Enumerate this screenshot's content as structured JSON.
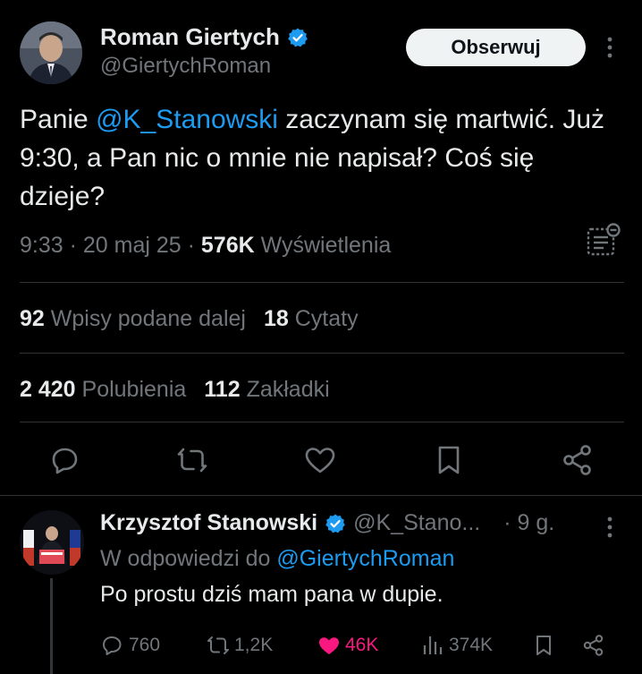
{
  "main_tweet": {
    "author_name": "Roman Giertych",
    "author_handle": "@GiertychRoman",
    "follow_label": "Obserwuj",
    "text_prefix": "Panie ",
    "text_mention": "@K_Stanowski",
    "text_rest": " zaczynam się martwić. Już 9:30, a Pan nic o mnie nie napisał? Coś się dzieje?",
    "time": "9:33",
    "date": "20 maj 25",
    "views_count": "576K",
    "views_label": "Wyświetlenia",
    "reposts_count": "92",
    "reposts_label": "Wpisy podane dalej",
    "quotes_count": "18",
    "quotes_label": "Cytaty",
    "likes_count": "2 420",
    "likes_label": "Polubienia",
    "bookmarks_count": "112",
    "bookmarks_label": "Zakładki"
  },
  "reply": {
    "author_name": "Krzysztof Stanowski",
    "author_handle": "@K_Stano...",
    "time": "9 g.",
    "in_reply_prefix": "W odpowiedzi do ",
    "in_reply_mention": "@GiertychRoman",
    "text": "Po prostu dziś mam pana w dupie.",
    "replies": "760",
    "reposts": "1,2K",
    "likes": "46K",
    "views": "374K"
  },
  "colors": {
    "background": "#000000",
    "text": "#e7e9ea",
    "muted": "#71767b",
    "link": "#1d9bf0",
    "like": "#f91880",
    "verified": "#1d9bf0"
  },
  "icons": [
    "verified-badge-icon",
    "more-options-icon",
    "post-analytics-icon",
    "reply-icon",
    "repost-icon",
    "like-icon",
    "bookmark-icon",
    "share-icon",
    "views-icon"
  ]
}
